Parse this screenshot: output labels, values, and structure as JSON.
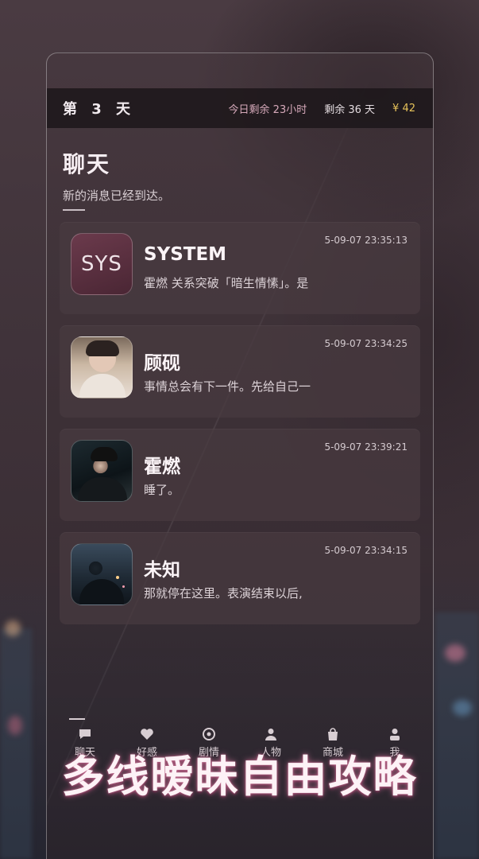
{
  "status": {
    "day": "第 3 天",
    "today_remaining": "今日剩余 23小时",
    "days_remaining": "剩余 36 天",
    "coins": "¥ 42"
  },
  "page": {
    "title": "聊天",
    "subtitle": "新的消息已经到达。"
  },
  "chats": [
    {
      "name": "SYSTEM",
      "avatar_text": "SYS",
      "preview": "霍燃 关系突破「暗生情愫」。是",
      "time": "2025-09-07 23:35:13"
    },
    {
      "name": "顾砚",
      "preview": "事情总会有下一件。先给自己一",
      "time": "2025-09-07 23:34:25"
    },
    {
      "name": "霍燃",
      "preview": "睡了。",
      "time": "2025-09-07 23:39:21"
    },
    {
      "name": "未知",
      "preview": "那就停在这里。表演结束以后,",
      "time": "2025-09-07 23:34:15"
    }
  ],
  "tabs": [
    {
      "label": "聊天",
      "icon": "chat-icon"
    },
    {
      "label": "好感",
      "icon": "heart-icon"
    },
    {
      "label": "剧情",
      "icon": "target-icon"
    },
    {
      "label": "人物",
      "icon": "person-icon"
    },
    {
      "label": "商城",
      "icon": "bag-icon"
    },
    {
      "label": "我",
      "icon": "user-icon"
    }
  ],
  "slogan": "多线暧昧自由攻略",
  "colors": {
    "accent_pink": "#d6a9ba",
    "coin_gold": "#e6c25a",
    "slogan_glow": "#c46d90"
  }
}
